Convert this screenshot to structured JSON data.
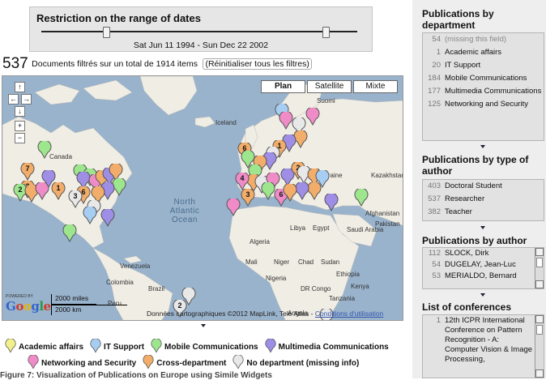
{
  "date_filter": {
    "title": "Restriction on the range of dates",
    "range_text": "Sat Jun 11 1994 - Sun Dec 22 2002"
  },
  "results": {
    "count": "537",
    "summary": "Documents filtrés sur un total de 1914 items",
    "reset_label": "(Réinitialiser tous les filtres)"
  },
  "map": {
    "type_buttons": [
      {
        "label": "Plan",
        "active": true
      },
      {
        "label": "Satellite",
        "active": false
      },
      {
        "label": "Mixte",
        "active": false
      }
    ],
    "nav": {
      "up": "↑",
      "left": "←",
      "right": "→",
      "down": "↓",
      "zoom_in": "+",
      "zoom_out": "−"
    },
    "place_labels": {
      "canada": "Canada",
      "iceland": "Iceland",
      "suomi": "Suomi",
      "north_atlantic_ocean": "North Atlantic Ocean",
      "kazakhstan": "Kazakhstan",
      "ukraine": "Ukraine",
      "afghanistan": "Afghanistan",
      "algeria": "Algeria",
      "libya": "Libya",
      "egypt": "Egypt",
      "saudi_arabia": "Saudi Arabia",
      "mali": "Mali",
      "niger": "Niger",
      "chad": "Chad",
      "sudan": "Sudan",
      "nigeria": "Nigeria",
      "ethiopia": "Ethiopia",
      "venezuela": "Venezuela",
      "colombia": "Colombia",
      "dr_congo": "DR Congo",
      "peru": "Peru",
      "brazil": "Brazil",
      "angola": "Angola",
      "tanzania": "Tanzania",
      "kenya": "Kenya",
      "pakistan": "Pakistan"
    },
    "logo_text": "Google",
    "powered_by": "POWERED BY",
    "scale_miles": "2000 miles",
    "scale_km": "2000 km",
    "copyright": "Données cartographiques ©2012 MapLink, Tele Atlas -",
    "terms_link": "Conditions d'utilisation",
    "markers_legend": [
      {
        "label": "Academic affairs",
        "color": "#f2f08a"
      },
      {
        "label": "IT Support",
        "color": "#a8cdf2"
      },
      {
        "label": "Mobile Communications",
        "color": "#9ee68e"
      },
      {
        "label": "Multimedia Communications",
        "color": "#9e8ee6"
      },
      {
        "label": "Networking and Security",
        "color": "#ef8cc8"
      },
      {
        "label": "Cross-department",
        "color": "#f2ad6a"
      },
      {
        "label": "No department (missing info)",
        "color": "#e8e8e8"
      }
    ],
    "marker_numbers": [
      "3",
      "7",
      "2",
      "2",
      "4",
      "1",
      "6",
      "3",
      "1",
      "2",
      "6",
      "6",
      "4",
      "3",
      "2",
      "4",
      "1",
      "3"
    ]
  },
  "caption": "Figure 7: Visualization of Publications on Europe using Simile Widgets",
  "sidebar": {
    "by_department": {
      "title": "Publications by department",
      "items": [
        {
          "count": "54",
          "label": "(missing this field)",
          "muted": true
        },
        {
          "count": "1",
          "label": "Academic affairs"
        },
        {
          "count": "20",
          "label": "IT Support"
        },
        {
          "count": "184",
          "label": "Mobile Communications"
        },
        {
          "count": "177",
          "label": "Multimedia Communications"
        },
        {
          "count": "125",
          "label": "Networking and Security"
        }
      ]
    },
    "by_author_type": {
      "title": "Publications by type of author",
      "items": [
        {
          "count": "403",
          "label": "Doctoral Student"
        },
        {
          "count": "537",
          "label": "Researcher"
        },
        {
          "count": "382",
          "label": "Teacher"
        }
      ]
    },
    "by_author": {
      "title": "Publications by author",
      "items": [
        {
          "count": "112",
          "label": "SLOCK, Dirk"
        },
        {
          "count": "54",
          "label": "DUGELAY, Jean-Luc"
        },
        {
          "count": "53",
          "label": "MERIALDO, Bernard"
        }
      ]
    },
    "conferences": {
      "title": "List of conferences",
      "items": [
        {
          "count": "1",
          "label": "12th ICPR International Conference on Pattern Recognition - A: Computer Vision & Image Processing,"
        }
      ]
    }
  }
}
